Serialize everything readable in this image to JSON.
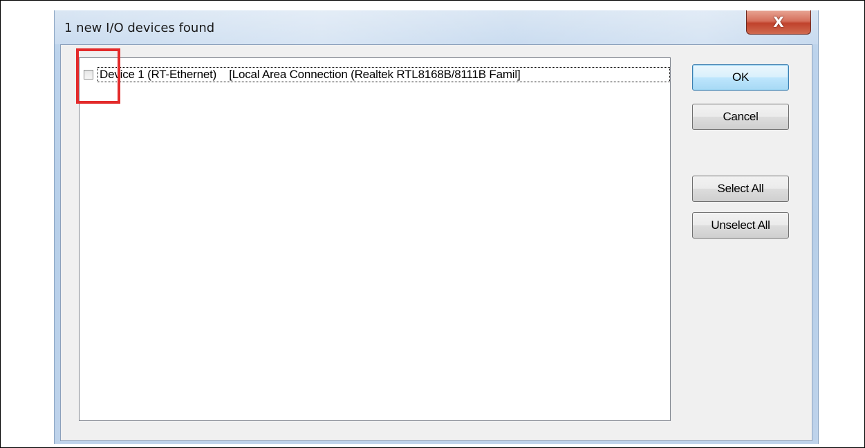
{
  "window": {
    "title": "1 new I/O devices found",
    "close_glyph": "X"
  },
  "device_list": {
    "items": [
      {
        "label": "Device 1 (RT-Ethernet)    [Local Area Connection (Realtek RTL8168B/8111B Famil]",
        "checked": false
      }
    ]
  },
  "buttons": {
    "ok": "OK",
    "cancel": "Cancel",
    "select_all": "Select All",
    "unselect_all": "Unselect All"
  },
  "colors": {
    "highlight": "#e32b2b",
    "close_button": "#c0422c"
  },
  "icons": {
    "close": "close-icon"
  }
}
